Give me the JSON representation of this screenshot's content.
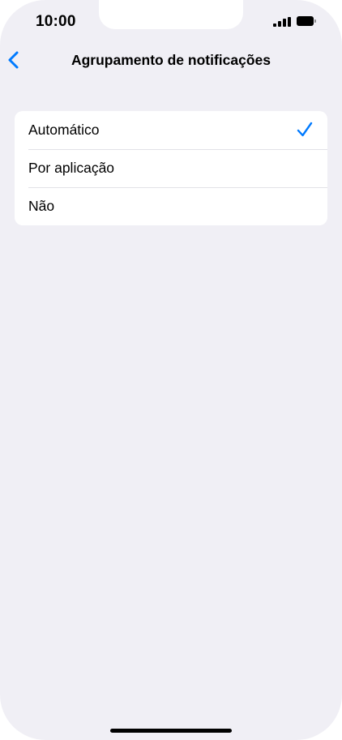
{
  "status_bar": {
    "time": "10:00",
    "signal_icon": "cellular-signal-icon",
    "battery_icon": "battery-icon"
  },
  "nav": {
    "back_icon": "chevron-left-icon",
    "title": "Agrupamento de notificações"
  },
  "options": [
    {
      "label": "Automático",
      "selected": true
    },
    {
      "label": "Por aplicação",
      "selected": false
    },
    {
      "label": "Não",
      "selected": false
    }
  ],
  "colors": {
    "accent": "#007aff",
    "background": "#f0eff5",
    "card": "#ffffff",
    "separator": "#e2e2e7"
  }
}
